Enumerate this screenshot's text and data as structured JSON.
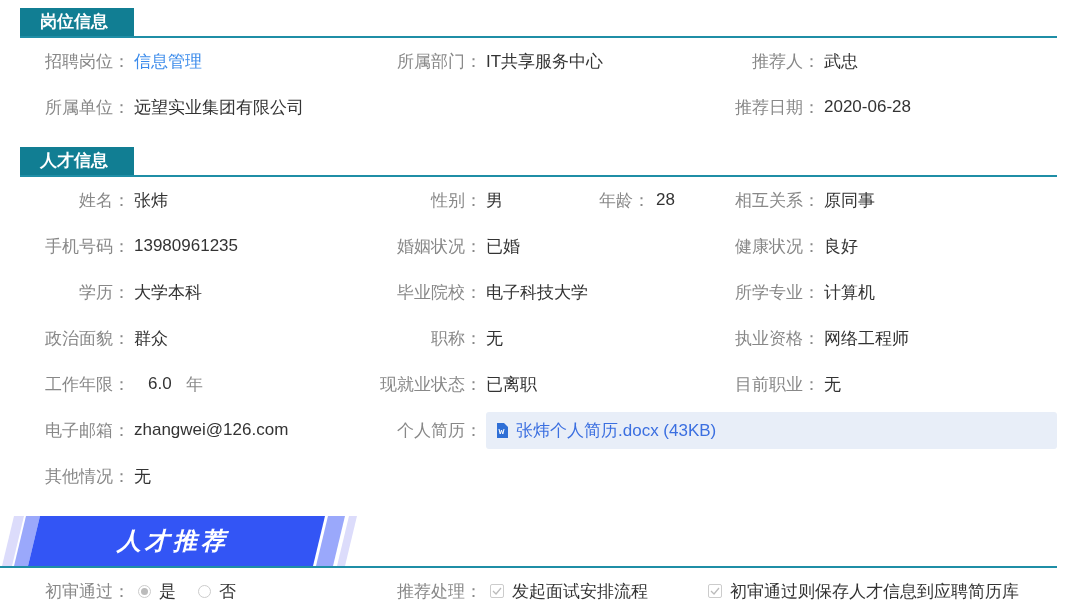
{
  "sections": [
    {
      "kind": "tab",
      "title": "岗位信息",
      "rows": [
        [
          {
            "label": "招聘岗位：",
            "kind": "link",
            "value": "信息管理"
          },
          {
            "label": "所属部门：",
            "kind": "text",
            "value": "IT共享服务中心"
          },
          {
            "label": "推荐人：",
            "kind": "text",
            "value": "武忠"
          }
        ],
        [
          {
            "label": "所属单位：",
            "kind": "text",
            "value": "远望实业集团有限公司"
          },
          {
            "kind": "empty"
          },
          {
            "label": "推荐日期：",
            "kind": "text",
            "value": "2020-06-28"
          }
        ]
      ]
    },
    {
      "kind": "tab",
      "title": "人才信息",
      "rows": [
        [
          {
            "label": "姓名：",
            "kind": "text",
            "value": "张炜"
          },
          {
            "label": "性别：",
            "kind": "pair",
            "value": "男",
            "extra_label": "年龄：",
            "extra_value": "28"
          },
          {
            "label": "相互关系：",
            "kind": "text",
            "value": "原同事"
          }
        ],
        [
          {
            "label": "手机号码：",
            "kind": "text",
            "value": "13980961235"
          },
          {
            "label": "婚姻状况：",
            "kind": "text",
            "value": "已婚"
          },
          {
            "label": "健康状况：",
            "kind": "text",
            "value": "良好"
          }
        ],
        [
          {
            "label": "学历：",
            "kind": "text",
            "value": "大学本科"
          },
          {
            "label": "毕业院校：",
            "kind": "text",
            "value": "电子科技大学"
          },
          {
            "label": "所学专业：",
            "kind": "text",
            "value": "计算机"
          }
        ],
        [
          {
            "label": "政治面貌：",
            "kind": "text",
            "value": "群众"
          },
          {
            "label": "职称：",
            "kind": "text",
            "value": "无"
          },
          {
            "label": "执业资格：",
            "kind": "text",
            "value": "网络工程师"
          }
        ],
        [
          {
            "label": "工作年限：",
            "kind": "unit",
            "value": "6.0",
            "unit": "年"
          },
          {
            "label": "现就业状态：",
            "kind": "text",
            "value": "已离职"
          },
          {
            "label": "目前职业：",
            "kind": "text",
            "value": "无"
          }
        ],
        [
          {
            "label": "电子邮箱：",
            "kind": "text",
            "value": "zhangwei@126.com"
          },
          {
            "label": "个人简历：",
            "kind": "file",
            "value": "张炜个人简历.docx (43KB)"
          }
        ],
        [
          {
            "label": "其他情况：",
            "kind": "text",
            "value": "无"
          }
        ]
      ]
    },
    {
      "kind": "banner",
      "title": "人才推荐",
      "rows": [
        [
          {
            "label": "初审通过：",
            "kind": "radio",
            "options": [
              {
                "label": "是",
                "selected": true
              },
              {
                "label": "否",
                "selected": false
              }
            ]
          },
          {
            "label": "推荐处理：",
            "kind": "checkbox",
            "options": [
              {
                "label": "发起面试安排流程",
                "checked": true
              },
              {
                "label": "初审通过则保存人才信息到应聘简历库",
                "checked": true
              }
            ]
          }
        ]
      ]
    }
  ]
}
